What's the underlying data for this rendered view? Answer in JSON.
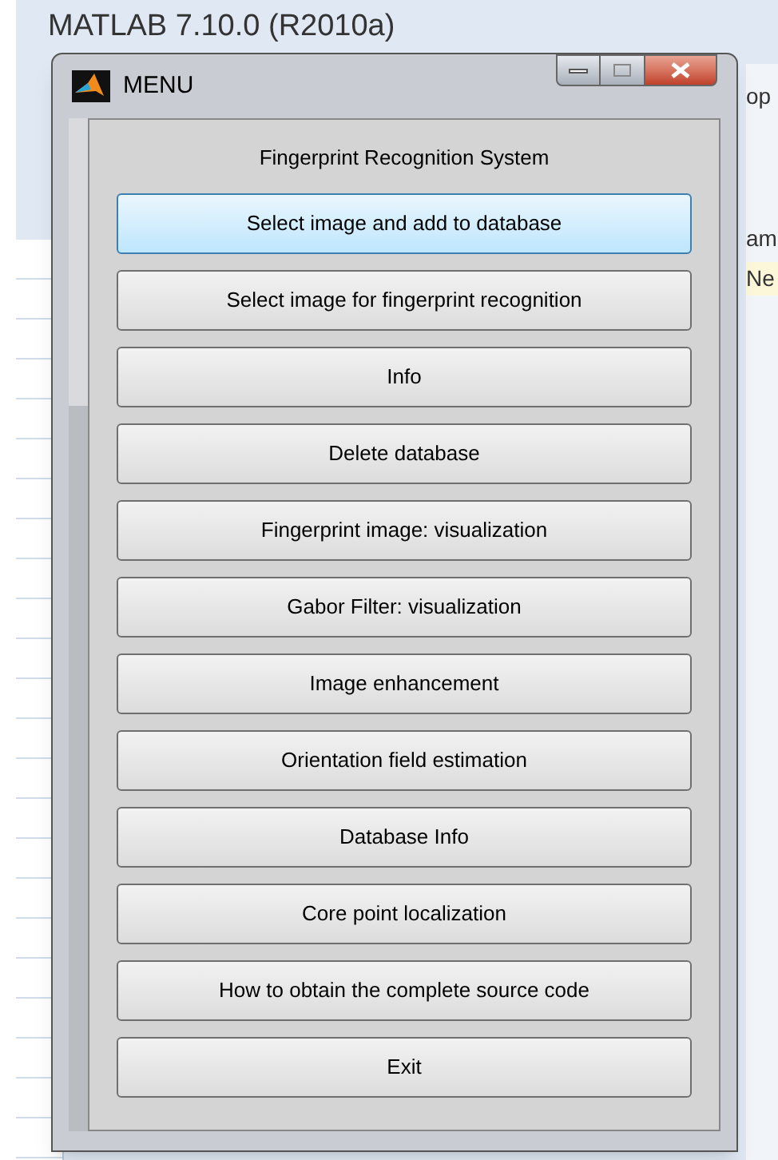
{
  "background_window": {
    "title": "MATLAB  7.10.0 (R2010a)",
    "fragments": [
      "op",
      "am",
      "Ne"
    ]
  },
  "window": {
    "title": "MENU"
  },
  "heading": "Fingerprint Recognition System",
  "buttons": [
    {
      "label": "Select image and add to database",
      "selected": true
    },
    {
      "label": "Select image for fingerprint recognition",
      "selected": false
    },
    {
      "label": "Info",
      "selected": false
    },
    {
      "label": "Delete database",
      "selected": false
    },
    {
      "label": "Fingerprint image: visualization",
      "selected": false
    },
    {
      "label": "Gabor Filter: visualization",
      "selected": false
    },
    {
      "label": "Image enhancement",
      "selected": false
    },
    {
      "label": "Orientation field estimation",
      "selected": false
    },
    {
      "label": "Database Info",
      "selected": false
    },
    {
      "label": "Core point localization",
      "selected": false
    },
    {
      "label": "How to obtain the complete source code",
      "selected": false
    },
    {
      "label": "Exit",
      "selected": false
    }
  ]
}
